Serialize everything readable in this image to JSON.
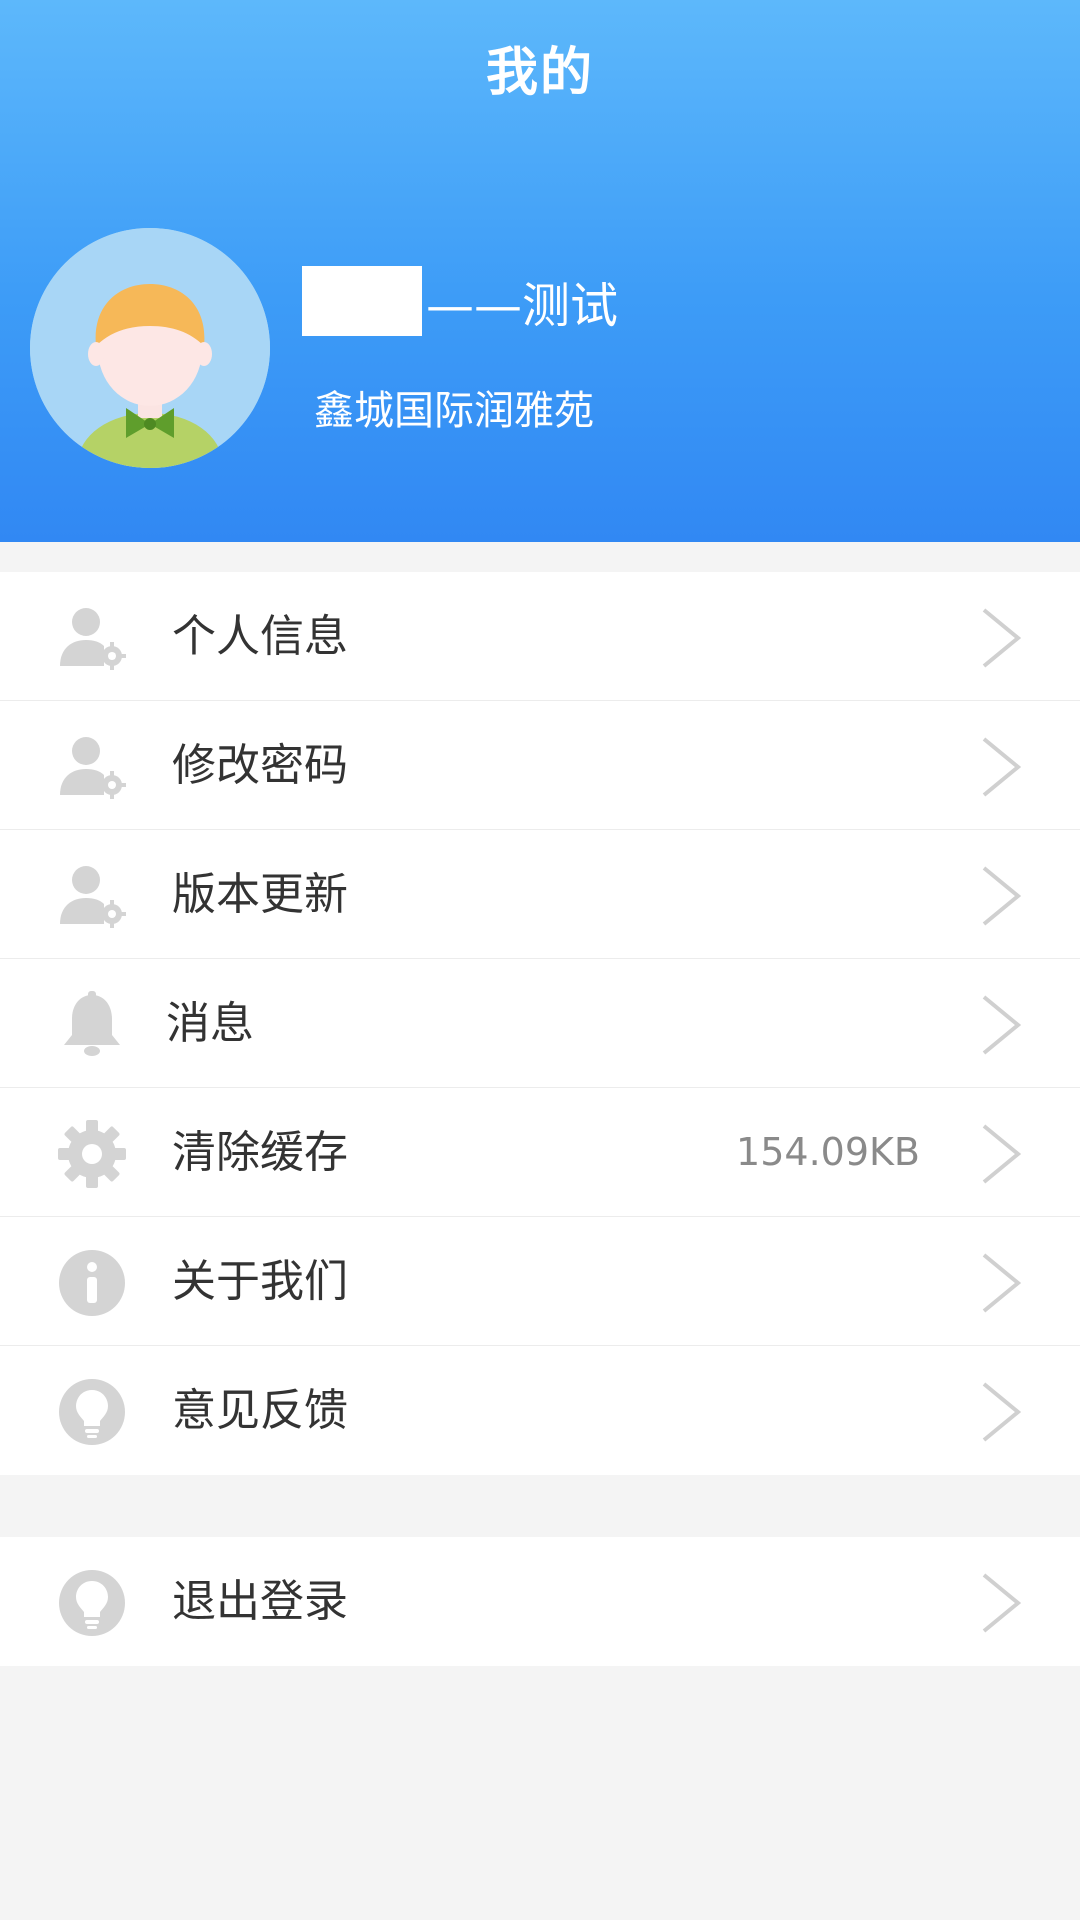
{
  "header": {
    "title": "我的",
    "name_suffix": "——测试",
    "community": "鑫城国际润雅苑",
    "background_top": "#5db8fb",
    "background_bottom": "#3188f3"
  },
  "menu": {
    "items": [
      {
        "label": "个人信息",
        "icon": "user-settings-icon"
      },
      {
        "label": "修改密码",
        "icon": "user-settings-icon"
      },
      {
        "label": "版本更新",
        "icon": "user-settings-icon"
      },
      {
        "label": "消息",
        "icon": "bell-icon"
      },
      {
        "label": "清除缓存",
        "icon": "gear-icon",
        "value": "154.09KB"
      },
      {
        "label": "关于我们",
        "icon": "info-icon"
      },
      {
        "label": "意见反馈",
        "icon": "lightbulb-icon"
      }
    ],
    "logout": {
      "label": "退出登录",
      "icon": "lightbulb-icon"
    }
  },
  "colors": {
    "icon_gray": "#d4d4d4",
    "chevron_gray": "#d0d0d0",
    "label_text": "#333333",
    "page_background": "#f4f4f4"
  }
}
